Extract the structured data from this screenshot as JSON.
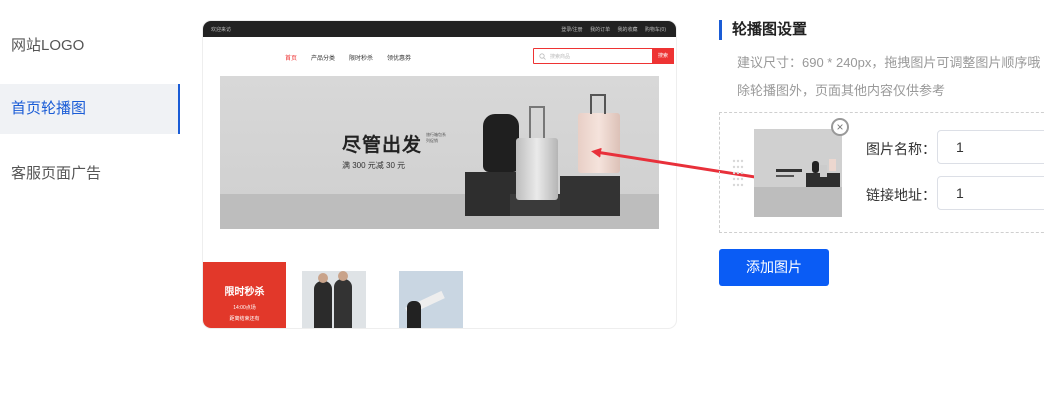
{
  "sidebar": {
    "items": [
      {
        "label": "网站LOGO",
        "active": false
      },
      {
        "label": "首页轮播图",
        "active": true
      },
      {
        "label": "客服页面广告",
        "active": false
      }
    ]
  },
  "preview": {
    "topbar": {
      "left": "欢迎来访",
      "links": [
        "登录/注册",
        "我的订单",
        "我的收藏",
        "购物车(0)"
      ]
    },
    "nav": [
      "首页",
      "产品分类",
      "限时秒杀",
      "领优惠券"
    ],
    "search": {
      "placeholder": "搜索商品",
      "button": "搜索"
    },
    "banner": {
      "title": "尽管出发",
      "subtitle": "满 300 元减 30 元",
      "small": "旅行箱包系列促销"
    },
    "flash_sale": {
      "title": "限时秒杀",
      "time": "14:00点场",
      "sub": "距离结束还有"
    }
  },
  "settings": {
    "title": "轮播图设置",
    "hint1": "建议尺寸：690 * 240px，拖拽图片可调整图片顺序哦",
    "hint2": "除轮播图外，页面其他内容仅供参考",
    "item": {
      "name_label": "图片名称：",
      "name_value": "1",
      "link_label": "链接地址：",
      "link_value": "1"
    },
    "add_button": "添加图片"
  },
  "colors": {
    "accent": "#1a5cd6",
    "button": "#0a5cf5",
    "red": "#e2382a"
  }
}
